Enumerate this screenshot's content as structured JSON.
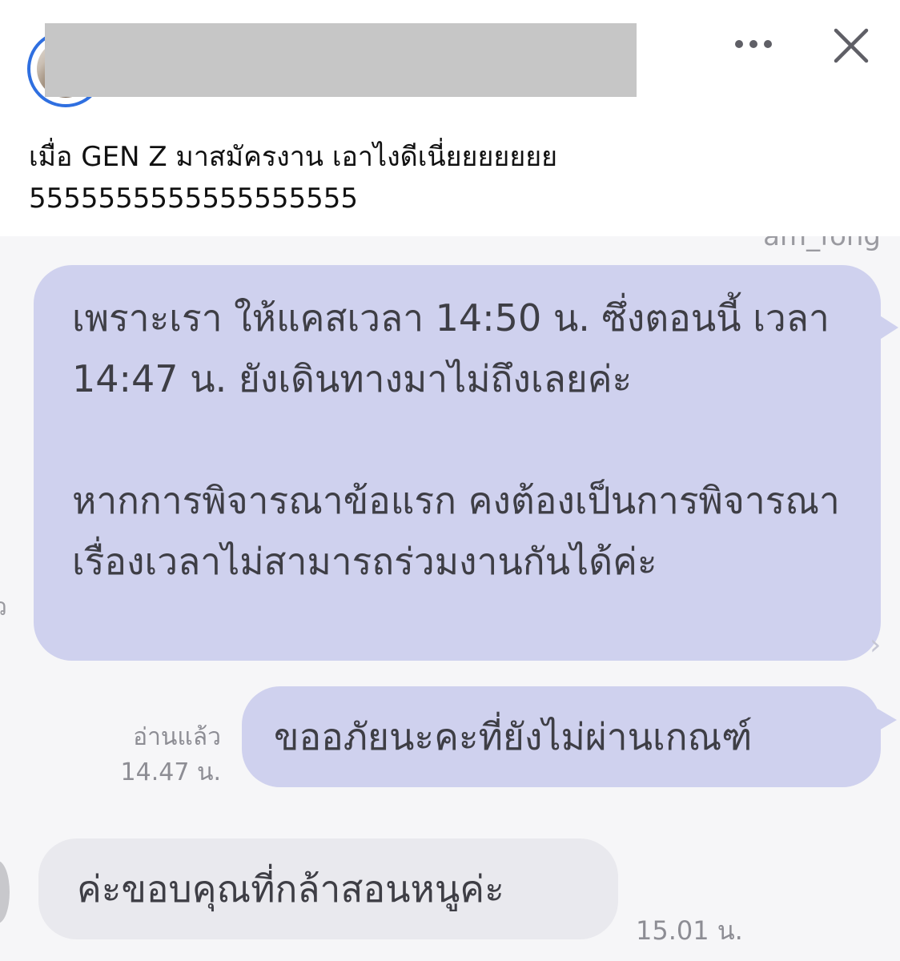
{
  "post": {
    "caption": "เมื่อ GEN Z มาสมัครงาน เอาไงดีเนี่ยยยยยยย\n5555555555555555555"
  },
  "chat": {
    "sender_name": "am_fong",
    "messages": [
      {
        "side": "incoming",
        "paragraphs": [
          "เพราะเรา ให้แคสเวลา 14:50 น. ซึ่งตอนนี้ เวลา 14:47 น. ยังเดินทางมาไม่ถึงเลยค่ะ",
          "หากการพิจารณาข้อแรก คงต้องเป็นการพิจารณาเรื่องเวลาไม่สามารถร่วมงานกันได้ค่ะ"
        ]
      },
      {
        "side": "incoming",
        "text": "ขออภัยนะคะที่ยังไม่ผ่านเกณฑ์",
        "read_status": "อ่านแล้ว",
        "time": "14.47 น."
      },
      {
        "side": "reply",
        "text": "ค่ะขอบคุณที่กล้าสอนหนูค่ะ",
        "time": "15.01 น."
      }
    ]
  },
  "icons": {
    "more": "more-horizontal-icon",
    "close": "close-icon"
  },
  "colors": {
    "avatar_ring": "#2f6fe0",
    "bubble_purple": "#cfd1ee",
    "bubble_gray": "#e9e9ee",
    "muted_text": "#8d8d94"
  }
}
